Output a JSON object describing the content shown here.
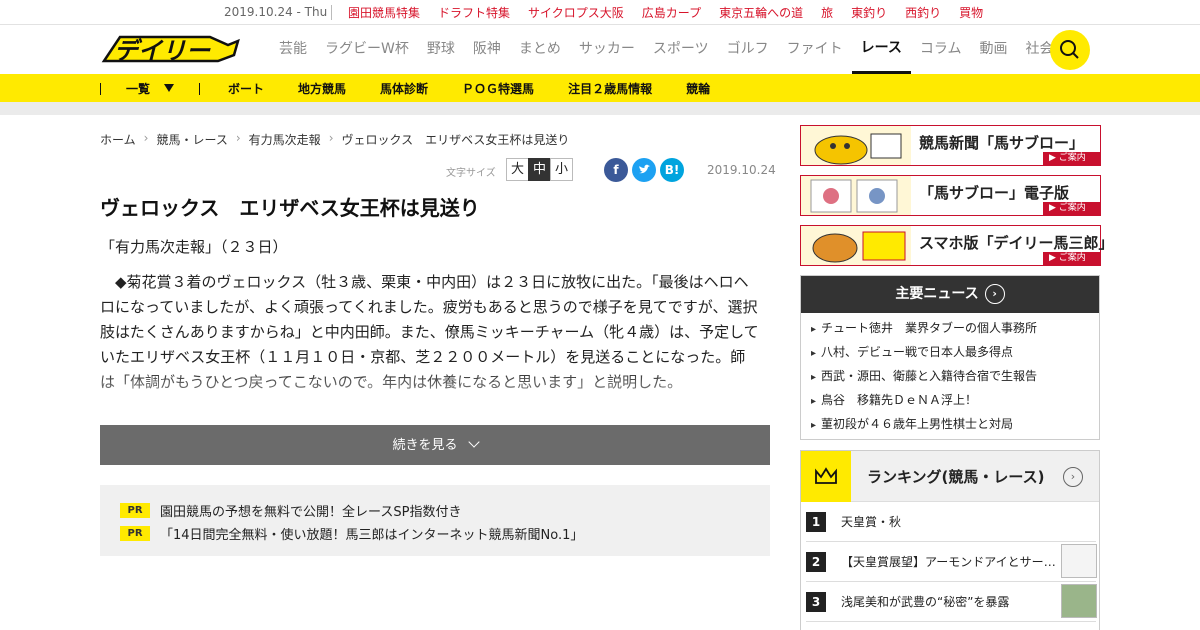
{
  "topbar": {
    "date": "2019.10.24 - Thu",
    "links": [
      "園田競馬特集",
      "ドラフト特集",
      "サイクロプス大阪",
      "広島カープ",
      "東京五輪への道",
      "旅",
      "東釣り",
      "西釣り",
      "買物"
    ]
  },
  "header": {
    "logo_text": "デイリー",
    "nav": [
      "芸能",
      "ラグビーW杯",
      "野球",
      "阪神",
      "まとめ",
      "サッカー",
      "スポーツ",
      "ゴルフ",
      "ファイト",
      "レース",
      "コラム",
      "動画",
      "社会"
    ],
    "active_nav": "レース"
  },
  "subnav": {
    "list_label": "一覧",
    "items": [
      "ボート",
      "地方競馬",
      "馬体診断",
      "ＰＯＧ特選馬",
      "注目２歳馬情報",
      "競輪"
    ]
  },
  "breadcrumb": [
    "ホーム",
    "競馬・レース",
    "有力馬次走報",
    "ヴェロックス　エリザベス女王杯は見送り"
  ],
  "article": {
    "fontsize_label": "文字サイズ",
    "fontsize_options": [
      "大",
      "中",
      "小"
    ],
    "fontsize_selected": "中",
    "share": {
      "facebook": "f",
      "twitter": "t",
      "hatena": "B!"
    },
    "date": "2019.10.24",
    "title": "ヴェロックス　エリザベス女王杯は見送り",
    "lead": "「有力馬次走報」（２３日）",
    "body": "◆菊花賞３着のヴェロックス（牡３歳、栗東・中内田）は２３日に放牧に出た。「最後はヘロヘロになっていましたが、よく頑張ってくれました。疲労もあると思うので様子を見てですが、選択肢はたくさんありますからね」と中内田師。また、僚馬ミッキーチャーム（牝４歳）は、予定していたエリザベス女王杯（１１月１０日・京都、芝２２００メートル）を見送ることになった。師は「体調がもうひとつ戻ってこないので。年内は休養になると思います」と説明した。",
    "more_label": "続きを見る"
  },
  "pr": [
    {
      "tag": "PR",
      "text": "園田競馬の予想を無料で公開！全レースSP指数付き"
    },
    {
      "tag": "PR",
      "text": "「14日間完全無料・使い放題！馬三郎はインターネット競馬新聞No.1」"
    }
  ],
  "banners": [
    {
      "text": "競馬新聞「馬サブロー」",
      "cta": "▶ ご案内"
    },
    {
      "text": "「馬サブロー」電子版",
      "cta": "▶ ご案内"
    },
    {
      "text": "スマホ版「デイリー馬三郎」",
      "cta": "▶ ご案内"
    }
  ],
  "news": {
    "heading": "主要ニュース",
    "items": [
      "チュート徳井　業界タブーの個人事務所",
      "八村、デビュー戦で日本人最多得点",
      "西武・源田、衛藤と入籍待合宿で生報告",
      "鳥谷　移籍先ＤｅＮＡ浮上！",
      "菫初段が４６歳年上男性棋士と対局"
    ]
  },
  "ranking": {
    "heading": "ランキング(競馬・レース)",
    "items": [
      {
        "rank": "1",
        "text": "天皇賞・秋"
      },
      {
        "rank": "2",
        "text": "【天皇賞展望】アーモンドアイとサートゥルナーリア"
      },
      {
        "rank": "3",
        "text": "浅尾美和が武豊の“秘密”を暴露"
      }
    ]
  },
  "colors": {
    "accent_yellow": "#ffea00",
    "accent_red": "#d7142b",
    "banner_red": "#c8102e"
  }
}
